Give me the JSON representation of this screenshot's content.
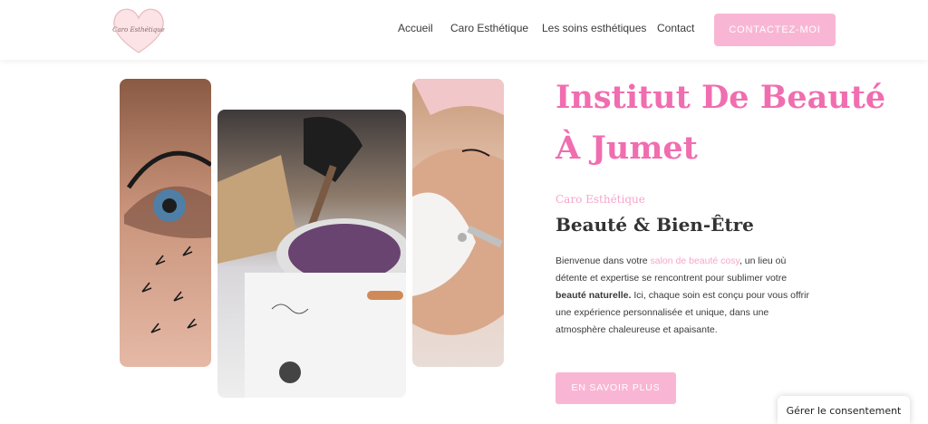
{
  "header": {
    "logo_text": "Caro Esthétique",
    "nav": [
      "Accueil",
      "Caro Esthétique",
      "Les soins esthétiques",
      "Contact"
    ],
    "cta_label": "CONTACTEZ-MOI"
  },
  "hero": {
    "title_line1": "Institut De Beauté",
    "title_line2": "À Jumet",
    "eyebrow": "Caro Esthétique",
    "subtitle": "Beauté & Bien-Être",
    "body": {
      "p1": "Bienvenue dans votre ",
      "highlight": "salon de beauté cosy",
      "p2": ", un lieu où détente et expertise se rencontrent pour sublimer votre ",
      "bold": "beauté naturelle.",
      "p3": " Ici, chaque soin est conçu pour vous offrir une expérience personnalisée et unique, dans une atmosphère chaleureuse et apaisante."
    },
    "cta_label": "EN SAVOIR PLUS"
  },
  "images": [
    "eyelash-photo",
    "wax-pot-photo",
    "facial-treatment-photo"
  ],
  "consent": {
    "label": "Gérer le consentement"
  },
  "colors": {
    "accent": "#f06db0",
    "button": "#f9b6d4",
    "light_pink": "#f7a5cb"
  }
}
